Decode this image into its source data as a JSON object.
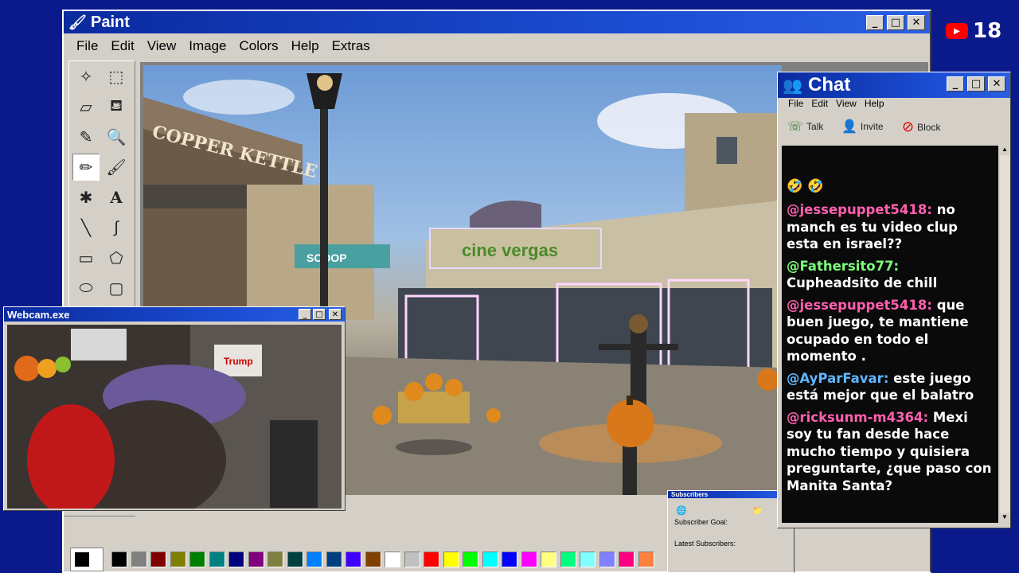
{
  "paint": {
    "title": "Paint",
    "menus": [
      "File",
      "Edit",
      "View",
      "Image",
      "Colors",
      "Help",
      "Extras"
    ],
    "controls": {
      "minimize": "_",
      "maximize": "□",
      "close": "✕"
    },
    "tools": [
      {
        "name": "free-select-icon",
        "glyph": "✧"
      },
      {
        "name": "rect-select-icon",
        "glyph": "⬚"
      },
      {
        "name": "eraser-icon",
        "glyph": "▱"
      },
      {
        "name": "fill-icon",
        "glyph": "⛾"
      },
      {
        "name": "color-picker-icon",
        "glyph": "✎"
      },
      {
        "name": "magnifier-icon",
        "glyph": "🔍"
      },
      {
        "name": "pencil-icon",
        "glyph": "✏"
      },
      {
        "name": "brush-icon",
        "glyph": "🖌"
      },
      {
        "name": "airbrush-icon",
        "glyph": "✱"
      },
      {
        "name": "text-icon",
        "glyph": "A"
      },
      {
        "name": "line-icon",
        "glyph": "╲"
      },
      {
        "name": "curve-icon",
        "glyph": "∫"
      },
      {
        "name": "rectangle-icon",
        "glyph": "▭"
      },
      {
        "name": "polygon-icon",
        "glyph": "⬠"
      },
      {
        "name": "ellipse-icon",
        "glyph": "⬭"
      },
      {
        "name": "rounded-rect-icon",
        "glyph": "▢"
      }
    ],
    "palette": [
      "#000000",
      "#808080",
      "#800000",
      "#808000",
      "#008000",
      "#008080",
      "#000080",
      "#800080",
      "#808040",
      "#004040",
      "#0080ff",
      "#004080",
      "#4000ff",
      "#804000",
      "#ffffff",
      "#c0c0c0",
      "#ff0000",
      "#ffff00",
      "#00ff00",
      "#00ffff",
      "#0000ff",
      "#ff00ff",
      "#ffff80",
      "#00ff80",
      "#80ffff",
      "#8080ff",
      "#ff0080",
      "#ff8040"
    ],
    "scene": {
      "sign_text": "cine vergas",
      "shop_sign": "COPPER KETTLE",
      "bakery_sign": "SCOOP"
    }
  },
  "webcam": {
    "title": "Webcam.exe",
    "controls": {
      "minimize": "_",
      "maximize": "□",
      "close": "✕"
    },
    "poster_text": "Trump"
  },
  "chat": {
    "title": "Chat",
    "menus": [
      "File",
      "Edit",
      "View",
      "Help"
    ],
    "toolbar": {
      "talk": "Talk",
      "invite": "Invite",
      "block": "Block"
    },
    "controls": {
      "minimize": "_",
      "maximize": "□",
      "close": "✕"
    },
    "partial_top": "🤣 🤣",
    "messages": [
      {
        "user": "@jessepuppet5418:",
        "text": " no manch es tu video clup esta en israel??",
        "color": "#ff5fb0"
      },
      {
        "user": "@Fathersito77:",
        "text": " Cupheadsito de chill",
        "color": "#7aff7a"
      },
      {
        "user": "@jessepuppet5418:",
        "text": " que buen juego, te mantiene ocupado en todo el momento .",
        "color": "#ff5fb0"
      },
      {
        "user": "@AyParFavar:",
        "text": " este juego está mejor que el balatro",
        "color": "#5fb6ff"
      },
      {
        "user": "@ricksunm-m4364:",
        "text": " Mexi soy tu fan desde hace mucho tiempo y quisiera preguntarte, ¿que paso con Manita Santa?",
        "color": "#ff5fb0"
      }
    ]
  },
  "subs": {
    "title": "Subscribers",
    "goal": "Subscriber Goal:",
    "latest": "Latest Subscribers:"
  },
  "youtube": {
    "count": "18",
    "accent": "#ff0000"
  }
}
